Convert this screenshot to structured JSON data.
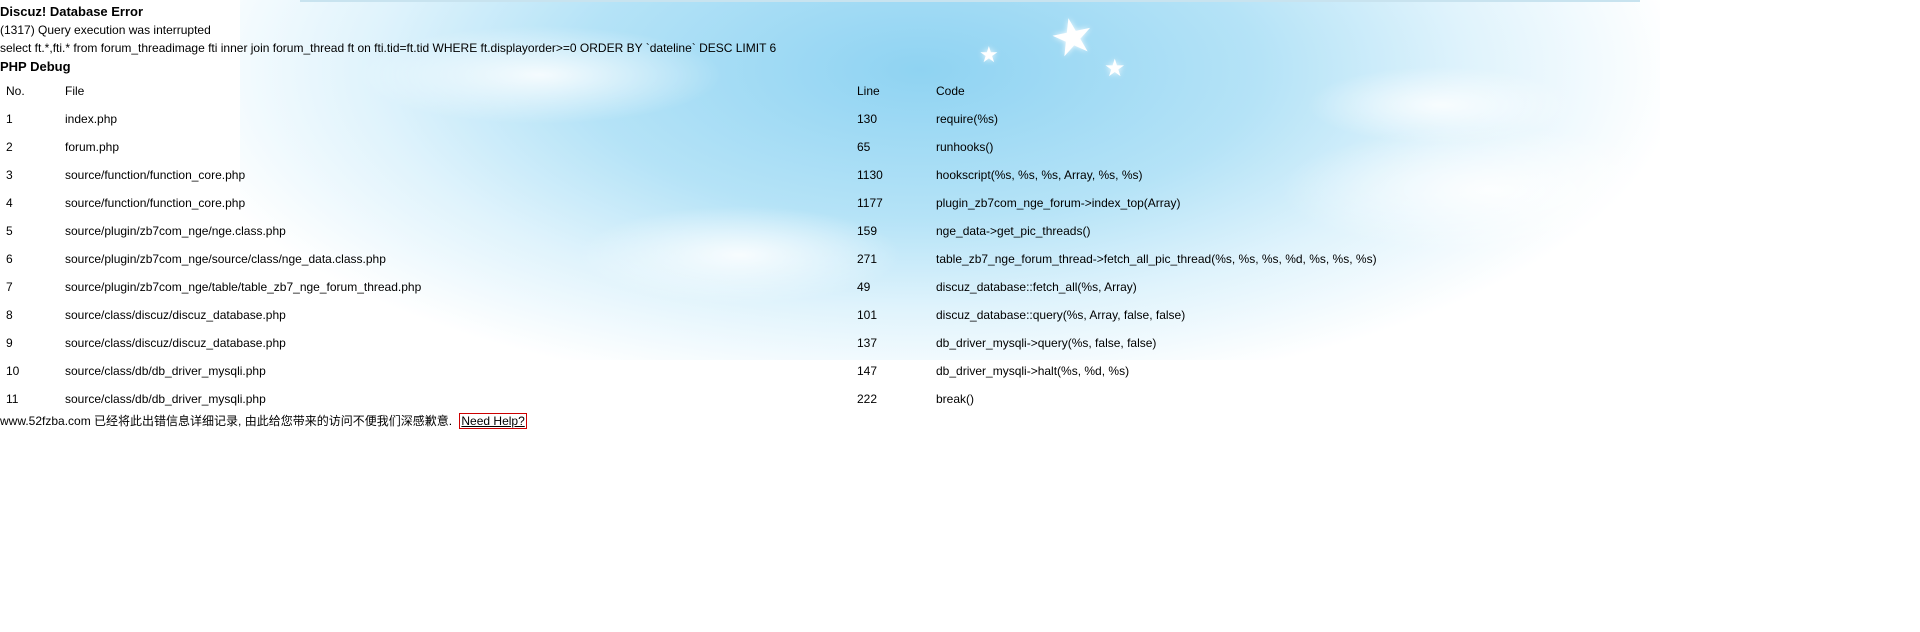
{
  "error": {
    "title": "Discuz! Database Error",
    "message": "(1317) Query execution was interrupted",
    "sql": "select ft.*,fti.* from forum_threadimage fti inner join forum_thread ft on fti.tid=ft.tid WHERE ft.displayorder>=0 ORDER BY `dateline` DESC LIMIT 6"
  },
  "debug": {
    "title": "PHP Debug",
    "headers": {
      "no": "No.",
      "file": "File",
      "line": "Line",
      "code": "Code"
    },
    "rows": [
      {
        "no": "1",
        "file": "index.php",
        "line": "130",
        "code": "require(%s)"
      },
      {
        "no": "2",
        "file": "forum.php",
        "line": "65",
        "code": "runhooks()"
      },
      {
        "no": "3",
        "file": "source/function/function_core.php",
        "line": "1130",
        "code": "hookscript(%s, %s, %s, Array, %s, %s)"
      },
      {
        "no": "4",
        "file": "source/function/function_core.php",
        "line": "1177",
        "code": "plugin_zb7com_nge_forum->index_top(Array)"
      },
      {
        "no": "5",
        "file": "source/plugin/zb7com_nge/nge.class.php",
        "line": "159",
        "code": "nge_data->get_pic_threads()"
      },
      {
        "no": "6",
        "file": "source/plugin/zb7com_nge/source/class/nge_data.class.php",
        "line": "271",
        "code": "table_zb7_nge_forum_thread->fetch_all_pic_thread(%s, %s, %s, %d, %s, %s, %s)"
      },
      {
        "no": "7",
        "file": "source/plugin/zb7com_nge/table/table_zb7_nge_forum_thread.php",
        "line": "49",
        "code": "discuz_database::fetch_all(%s, Array)"
      },
      {
        "no": "8",
        "file": "source/class/discuz/discuz_database.php",
        "line": "101",
        "code": "discuz_database::query(%s, Array, false, false)"
      },
      {
        "no": "9",
        "file": "source/class/discuz/discuz_database.php",
        "line": "137",
        "code": "db_driver_mysqli->query(%s, false, false)"
      },
      {
        "no": "10",
        "file": "source/class/db/db_driver_mysqli.php",
        "line": "147",
        "code": "db_driver_mysqli->halt(%s, %d, %s)"
      },
      {
        "no": "11",
        "file": "source/class/db/db_driver_mysqli.php",
        "line": "222",
        "code": "break()"
      }
    ]
  },
  "footer": {
    "text": "www.52fzba.com 已经将此出错信息详细记录, 由此给您带来的访问不便我们深感歉意.",
    "help_label": "Need Help?"
  },
  "colors": {
    "help_border": "#cc0000",
    "sky": "#8fd3f2"
  },
  "decor": {
    "stars": [
      "star-icon",
      "star-icon",
      "star-icon"
    ]
  }
}
